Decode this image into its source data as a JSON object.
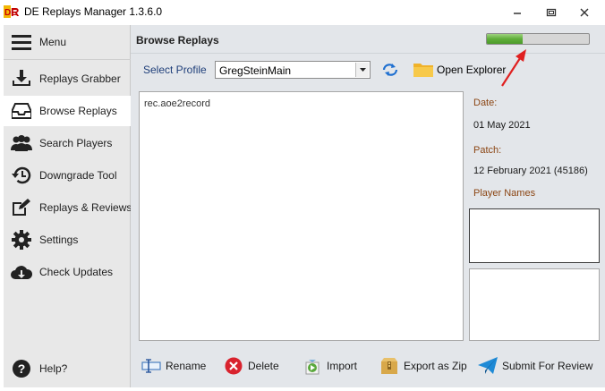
{
  "window": {
    "title": "DE Replays Manager 1.3.6.0",
    "controls": [
      "minimize-icon",
      "restore-icon",
      "close-icon"
    ]
  },
  "sidebar": {
    "menu_label": "Menu",
    "items": [
      {
        "label": "Replays Grabber",
        "icon": "download-icon"
      },
      {
        "label": "Browse Replays",
        "icon": "inbox-icon",
        "active": true
      },
      {
        "label": "Search Players",
        "icon": "users-icon"
      },
      {
        "label": "Downgrade Tool",
        "icon": "history-icon"
      },
      {
        "label": "Replays & Reviews",
        "icon": "edit-icon"
      },
      {
        "label": "Settings",
        "icon": "gear-icon"
      },
      {
        "label": "Check Updates",
        "icon": "cloud-download-icon"
      }
    ],
    "help_label": "Help?"
  },
  "main": {
    "header_title": "Browse Replays",
    "progress_fraction": 0.35,
    "profile_label": "Select Profile",
    "profile_value": "GregSteinMain",
    "open_explorer_label": "Open Explorer",
    "files": [
      "rec.aoe2record"
    ],
    "info": {
      "date_label": "Date:",
      "date_value": "01 May 2021",
      "patch_label": "Patch:",
      "patch_value": "12 February 2021 (45186)",
      "players_label": "Player Names"
    },
    "toolbar": {
      "rename": "Rename",
      "delete": "Delete",
      "import": "Import",
      "export": "Export as Zip",
      "submit": "Submit For Review"
    }
  },
  "colors": {
    "accent_brown": "#8b4513",
    "label_blue": "#1f3f7a",
    "progress_green": "#5fae3a",
    "annotation_red": "#e02020"
  }
}
